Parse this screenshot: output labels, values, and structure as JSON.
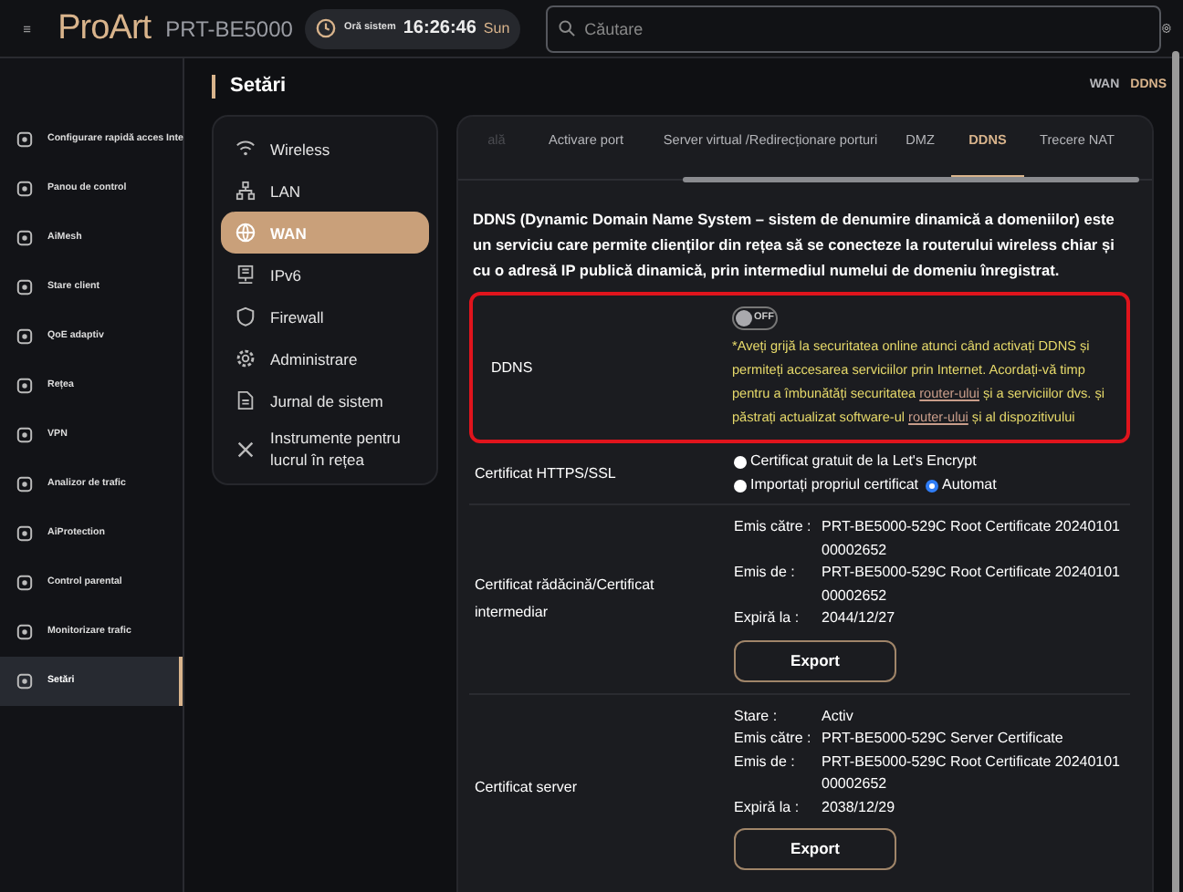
{
  "header": {
    "brand": "ProArt",
    "model": "PRT-BE5000",
    "clock": {
      "label": "Oră sistem",
      "time": "16:26:46",
      "day": "Sun"
    },
    "search": {
      "placeholder": "Căutare"
    }
  },
  "sidebar": {
    "items": [
      {
        "label": "Configurare rapidă acces Inte",
        "selected": false
      },
      {
        "label": "Panou de control",
        "selected": false
      },
      {
        "label": "AiMesh",
        "selected": false
      },
      {
        "label": "Stare client",
        "selected": false
      },
      {
        "label": "QoE adaptiv",
        "selected": false
      },
      {
        "label": "Rețea",
        "selected": false
      },
      {
        "label": "VPN",
        "selected": false
      },
      {
        "label": "Analizor de trafic",
        "selected": false
      },
      {
        "label": "AiProtection",
        "selected": false
      },
      {
        "label": "Control parental",
        "selected": false
      },
      {
        "label": "Monitorizare trafic",
        "selected": false
      },
      {
        "label": "Setări",
        "selected": true
      }
    ]
  },
  "page_title": "Setări",
  "breadcrumb": [
    {
      "label": "WAN",
      "selected": false
    },
    {
      "label": "DDNS",
      "selected": true
    }
  ],
  "settings_nav": {
    "items": [
      {
        "label": "Wireless",
        "selected": false
      },
      {
        "label": "LAN",
        "selected": false
      },
      {
        "label": "WAN",
        "selected": true
      },
      {
        "label": "IPv6",
        "selected": false
      },
      {
        "label": "Firewall",
        "selected": false
      },
      {
        "label": "Administrare",
        "selected": false
      },
      {
        "label": "Jurnal de sistem",
        "selected": false
      },
      {
        "label": "Instrumente pentru lucrul în rețea",
        "selected": false
      }
    ]
  },
  "tabs": [
    {
      "label": "ală",
      "selected": false
    },
    {
      "label": "Activare port",
      "selected": false
    },
    {
      "label": "Server virtual /Redirecționare porturi",
      "selected": false
    },
    {
      "label": "DMZ",
      "selected": false
    },
    {
      "label": "DDNS",
      "selected": true
    },
    {
      "label": "Trecere NAT",
      "selected": false
    }
  ],
  "description": "DDNS (Dynamic Domain Name System – sistem de denumire dinamică a domeniilor) este un serviciu care permite clienților din rețea să se conecteze la routerului wireless chiar și cu o adresă IP publică dinamică, prin intermediul numelui de domeniu înregistrat.",
  "ddns": {
    "label": "DDNS",
    "toggle": {
      "on": false,
      "text": "OFF"
    },
    "warning": [
      {
        "text": "*Aveți grijă la securitatea online atunci când activați DDNS și permiteți accesarea serviciilor prin Internet. Acordați-vă timp pentru a îmbunătăți securitatea ",
        "link": false
      },
      {
        "text": "router-ului",
        "link": true
      },
      {
        "text": " și a serviciilor dvs. și păstrați actualizat software-ul ",
        "link": false
      },
      {
        "text": "router-ului",
        "link": true
      },
      {
        "text": " și al dispozitivului",
        "link": false
      }
    ]
  },
  "https": {
    "label": "Certificat HTTPS/SSL",
    "options": [
      {
        "label": "Certificat gratuit de la Let's Encrypt",
        "selected": false
      },
      {
        "label": "Importați propriul certificat",
        "selected": false
      },
      {
        "label": "Automat",
        "selected": true
      }
    ]
  },
  "certificates": [
    {
      "label": "Certificat rădăcină/Certificat intermediar",
      "fields": [
        {
          "key": "Emis către :",
          "value": "PRT-BE5000-529C Root Certificate 2024010100002652"
        },
        {
          "key": "Emis de :",
          "value": "PRT-BE5000-529C Root Certificate 2024010100002652"
        },
        {
          "key": "Expiră la :",
          "value": "2044/12/27"
        }
      ],
      "button": "Export"
    },
    {
      "label": "Certificat server",
      "fields": [
        {
          "key": "Stare :",
          "value": "Activ"
        },
        {
          "key": "Emis către :",
          "value": "PRT-BE5000-529C Server Certificate"
        },
        {
          "key": "Emis de :",
          "value": "PRT-BE5000-529C Root Certificate 2024010100002652"
        },
        {
          "key": "Expiră la :",
          "value": "2038/12/29"
        }
      ],
      "button": "Export"
    }
  ]
}
